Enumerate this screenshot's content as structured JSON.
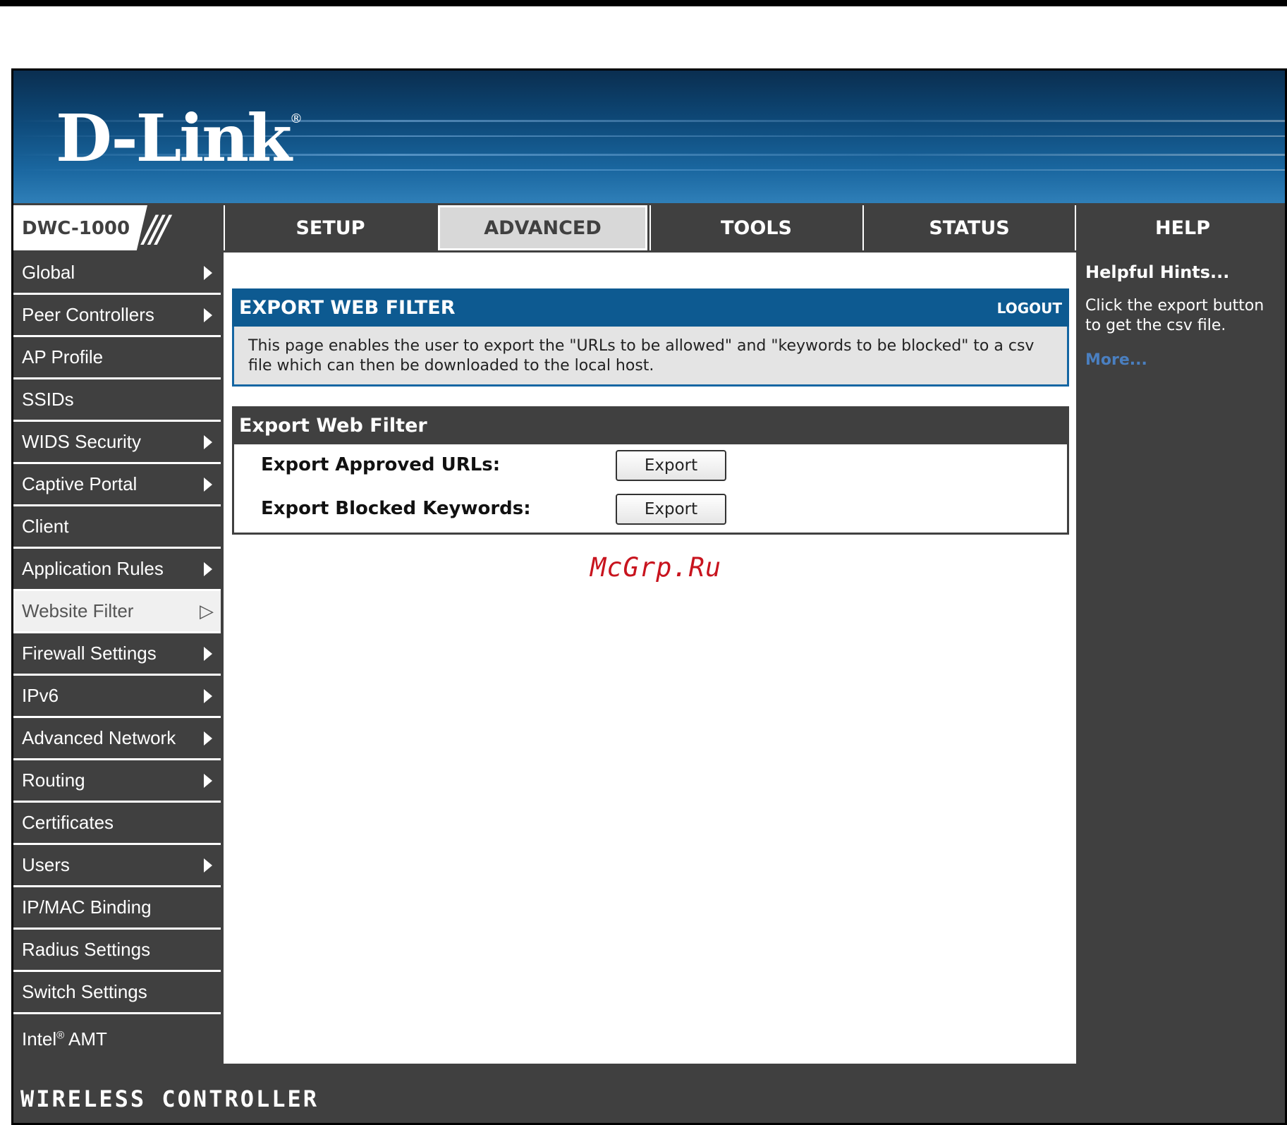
{
  "header": {
    "logo_text": "D-Link",
    "logo_mark": "®"
  },
  "model": {
    "label": "DWC-1000",
    "slashes": "///"
  },
  "nav": {
    "tabs": [
      {
        "label": "SETUP"
      },
      {
        "label": "ADVANCED",
        "active": true
      },
      {
        "label": "TOOLS"
      },
      {
        "label": "STATUS"
      },
      {
        "label": "HELP"
      }
    ]
  },
  "sidebar": {
    "items": [
      {
        "label": "Global",
        "arrow": true
      },
      {
        "label": "Peer Controllers",
        "arrow": true
      },
      {
        "label": "AP Profile",
        "arrow": false
      },
      {
        "label": "SSIDs",
        "arrow": false
      },
      {
        "label": "WIDS Security",
        "arrow": true
      },
      {
        "label": "Captive Portal",
        "arrow": true
      },
      {
        "label": "Client",
        "arrow": false
      },
      {
        "label": "Application Rules",
        "arrow": true
      },
      {
        "label": "Website Filter",
        "arrow": true,
        "active": true
      },
      {
        "label": "Firewall Settings",
        "arrow": true
      },
      {
        "label": "IPv6",
        "arrow": true
      },
      {
        "label": "Advanced Network",
        "arrow": true
      },
      {
        "label": "Routing",
        "arrow": true
      },
      {
        "label": "Certificates",
        "arrow": false
      },
      {
        "label": "Users",
        "arrow": true
      },
      {
        "label": "IP/MAC Binding",
        "arrow": false
      },
      {
        "label": "Radius Settings",
        "arrow": false
      },
      {
        "label": "Switch Settings",
        "arrow": false
      }
    ],
    "last_item": {
      "label_pre": "Intel",
      "label_sup": "®",
      "label_post": " AMT"
    }
  },
  "main": {
    "panel_title": "EXPORT WEB FILTER",
    "logout": "LOGOUT",
    "description": "This page enables the user to export the \"URLs to be allowed\" and \"keywords to be blocked\" to a csv file which can then be downloaded to the local host.",
    "section_title": "Export Web Filter",
    "rows": [
      {
        "label": "Export Approved URLs:",
        "button": "Export"
      },
      {
        "label": "Export Blocked Keywords:",
        "button": "Export"
      }
    ],
    "watermark": "McGrp.Ru"
  },
  "help": {
    "title": "Helpful Hints...",
    "text": "Click the export button to get the csv file.",
    "more": "More..."
  },
  "footer": {
    "text": "WIRELESS CONTROLLER"
  },
  "colors": {
    "accent_blue": "#0d5a91",
    "dark_gray": "#404040",
    "watermark_red": "#c8141e",
    "link_blue": "#4a7fc0"
  }
}
